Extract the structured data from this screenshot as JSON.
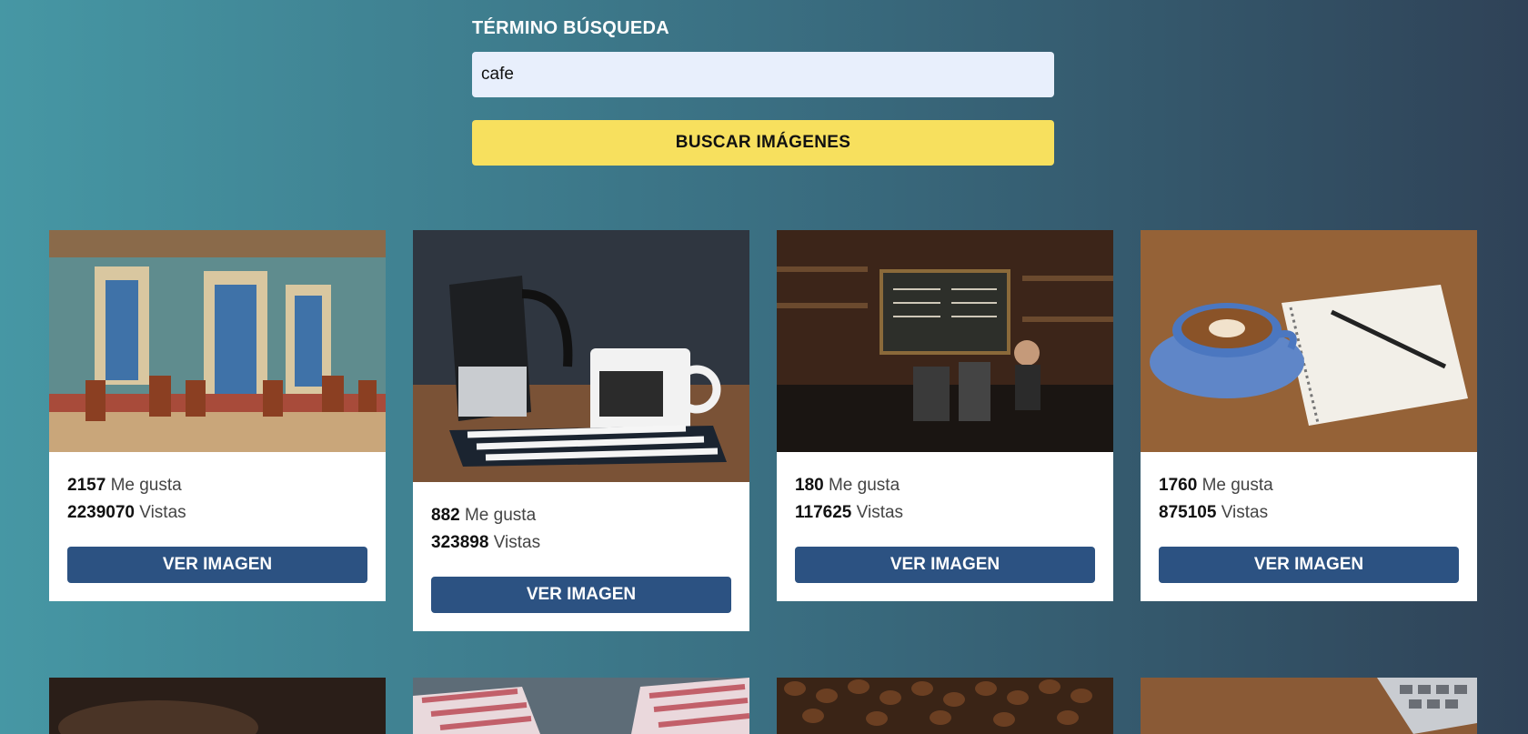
{
  "search": {
    "label": "TÉRMINO BÚSQUEDA",
    "value": "cafe",
    "button_label": "BUSCAR IMÁGENES"
  },
  "colors": {
    "accent_yellow": "#f7e05e",
    "button_blue": "#2c5282",
    "input_bg": "#e8effc"
  },
  "results": [
    {
      "likes": "2157",
      "likes_label": "Me gusta",
      "views": "2239070",
      "views_label": "Vistas",
      "button_label": "VER IMAGEN",
      "subject": "street-cafe-building"
    },
    {
      "likes": "882",
      "likes_label": "Me gusta",
      "views": "323898",
      "views_label": "Vistas",
      "button_label": "VER IMAGEN",
      "subject": "coffee-pot-and-mug"
    },
    {
      "likes": "180",
      "likes_label": "Me gusta",
      "views": "117625",
      "views_label": "Vistas",
      "button_label": "VER IMAGEN",
      "subject": "coffee-shop-counter"
    },
    {
      "likes": "1760",
      "likes_label": "Me gusta",
      "views": "875105",
      "views_label": "Vistas",
      "button_label": "VER IMAGEN",
      "subject": "latte-and-notebook"
    }
  ]
}
